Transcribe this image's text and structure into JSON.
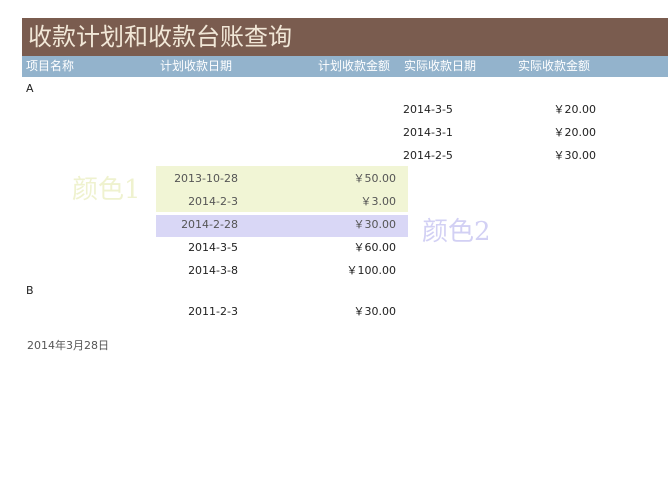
{
  "title": "收款计划和收款台账查询",
  "headers": {
    "project": "项目名称",
    "plan_date": "计划收款日期",
    "plan_amount": "计划收款金额",
    "actual_date": "实际收款日期",
    "actual_amount": "实际收款金额"
  },
  "project_a": {
    "name": "A",
    "actual": [
      {
        "date": "2014-3-5",
        "amount": "￥20.00"
      },
      {
        "date": "2014-3-1",
        "amount": "￥20.00"
      },
      {
        "date": "2014-2-5",
        "amount": "￥30.00"
      }
    ],
    "plan": [
      {
        "date": "2013-10-28",
        "amount": "￥50.00"
      },
      {
        "date": "2014-2-3",
        "amount": "￥3.00"
      },
      {
        "date": "2014-2-28",
        "amount": "￥30.00"
      },
      {
        "date": "2014-3-5",
        "amount": "￥60.00"
      },
      {
        "date": "2014-3-8",
        "amount": "￥100.00"
      }
    ]
  },
  "project_b": {
    "name": "B",
    "plan": [
      {
        "date": "2011-2-3",
        "amount": "￥30.00"
      }
    ]
  },
  "legend": {
    "color1": "颜色1",
    "color2": "颜色2"
  },
  "footer_date": "2014年3月28日",
  "colors": {
    "title_bg": "#7a5c4f",
    "header_bg": "#93b3cc",
    "band1": "#f1f5d5",
    "band2": "#d9d7f6"
  }
}
